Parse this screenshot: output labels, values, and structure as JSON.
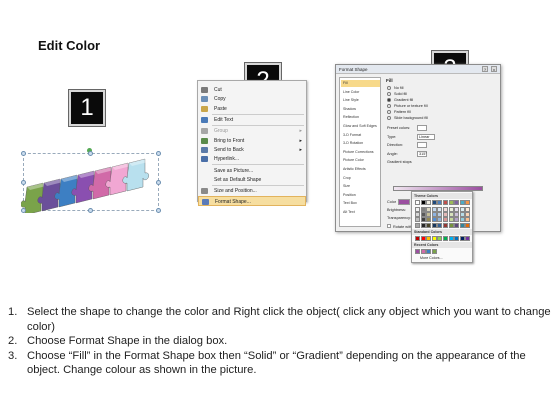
{
  "title": "Edit Color",
  "step_badges": [
    "1",
    "2",
    "3"
  ],
  "puzzle": {
    "colors": [
      "#7aa34a",
      "#6b4f9a",
      "#3d7fc3",
      "#8a4fb0",
      "#d16aa8",
      "#f1a7d3",
      "#b8e0ee"
    ]
  },
  "context_menu": {
    "items": [
      {
        "label": "Cut",
        "icon": "scissors-icon",
        "icon_color": "#7a7a7a",
        "has_submenu": false,
        "disabled": false,
        "selected": false
      },
      {
        "label": "Copy",
        "icon": "copy-icon",
        "icon_color": "#6b8fb8",
        "has_submenu": false,
        "disabled": false,
        "selected": false
      },
      {
        "label": "Paste",
        "icon": "paste-icon",
        "icon_color": "#c9a64a",
        "has_submenu": false,
        "disabled": false,
        "selected": false
      },
      {
        "label": "Edit Text",
        "icon": "edit-text-icon",
        "icon_color": "#4a7ab8",
        "has_submenu": false,
        "disabled": false,
        "selected": false
      },
      {
        "label": "Group",
        "icon": "group-icon",
        "icon_color": "#a6a6a6",
        "has_submenu": true,
        "disabled": true,
        "selected": false
      },
      {
        "label": "Bring to Front",
        "icon": "bring-front-icon",
        "icon_color": "#5a8a4a",
        "has_submenu": true,
        "disabled": false,
        "selected": false
      },
      {
        "label": "Send to Back",
        "icon": "send-back-icon",
        "icon_color": "#5a7aa8",
        "has_submenu": true,
        "disabled": false,
        "selected": false
      },
      {
        "label": "Hyperlink...",
        "icon": "hyperlink-icon",
        "icon_color": "#4a6fa8",
        "has_submenu": false,
        "disabled": false,
        "selected": false
      },
      {
        "label": "Save as Picture...",
        "icon": "",
        "icon_color": "",
        "has_submenu": false,
        "disabled": false,
        "selected": false
      },
      {
        "label": "Set as Default Shape",
        "icon": "",
        "icon_color": "",
        "has_submenu": false,
        "disabled": false,
        "selected": false
      },
      {
        "label": "Size and Position...",
        "icon": "size-position-icon",
        "icon_color": "#8a8a8a",
        "has_submenu": false,
        "disabled": false,
        "selected": false
      },
      {
        "label": "Format Shape...",
        "icon": "format-shape-icon",
        "icon_color": "#5a7ab8",
        "has_submenu": false,
        "disabled": false,
        "selected": true
      }
    ]
  },
  "format_dialog": {
    "title": "Format Shape",
    "window_buttons": [
      "?",
      "x"
    ],
    "categories": [
      "Fill",
      "Line Color",
      "Line Style",
      "Shadow",
      "Reflection",
      "Glow and Soft Edges",
      "3-D Format",
      "3-D Rotation",
      "Picture Corrections",
      "Picture Color",
      "Artistic Effects",
      "Crop",
      "Size",
      "Position",
      "Text Box",
      "Alt Text"
    ],
    "selected_category": "Fill",
    "pane_heading": "Fill",
    "fill_options": [
      {
        "label": "No fill",
        "checked": false
      },
      {
        "label": "Solid fill",
        "checked": false
      },
      {
        "label": "Gradient fill",
        "checked": true
      },
      {
        "label": "Picture or texture fill",
        "checked": false
      },
      {
        "label": "Pattern fill",
        "checked": false
      },
      {
        "label": "Slide background fill",
        "checked": false
      }
    ],
    "fields": [
      {
        "label": "Preset colors:",
        "value": ""
      },
      {
        "label": "Type:",
        "value": "Linear"
      },
      {
        "label": "Direction:",
        "value": ""
      },
      {
        "label": "Angle:",
        "value": "315°"
      },
      {
        "label": "Gradient stops",
        "value": ""
      }
    ],
    "lower_labels": [
      "Color",
      "Brightness:",
      "Transparency:",
      "Rotate with shape"
    ],
    "gradient_colors": [
      "#f0e6f0",
      "#9b4fa0"
    ]
  },
  "palette": {
    "theme_heading": "Theme Colors",
    "standard_heading": "Standard Colors",
    "recent_heading": "Recent Colors",
    "more_label": "More Colors...",
    "theme_top": [
      "#ffffff",
      "#000000",
      "#eeece1",
      "#1f497d",
      "#4f81bd",
      "#c0504d",
      "#9bbb59",
      "#8064a2",
      "#4bacc6",
      "#f79646"
    ],
    "theme_shades": [
      [
        "#f2f2f2",
        "#7f7f7f",
        "#ddd9c3",
        "#c6d9f0",
        "#dbe5f1",
        "#f2dcdb",
        "#ebf1dd",
        "#e5e0ec",
        "#dbeef3",
        "#fdeada"
      ],
      [
        "#d8d8d8",
        "#595959",
        "#c4bd97",
        "#8db3e2",
        "#b8cce4",
        "#e5b9b7",
        "#d7e3bc",
        "#ccc1d9",
        "#b7dde8",
        "#fbd5b5"
      ],
      [
        "#bfbfbf",
        "#3f3f3f",
        "#938953",
        "#548dd4",
        "#95b3d7",
        "#d99694",
        "#c3d69b",
        "#b2a2c7",
        "#92cddc",
        "#fac08f"
      ],
      [
        "#a5a5a5",
        "#262626",
        "#494429",
        "#17365d",
        "#366092",
        "#953734",
        "#76923c",
        "#5f497a",
        "#31859b",
        "#e36c09"
      ]
    ],
    "standard": [
      "#c00000",
      "#ff0000",
      "#ffc000",
      "#ffff00",
      "#92d050",
      "#00b050",
      "#00b0f0",
      "#0070c0",
      "#002060",
      "#7030a0"
    ],
    "recent": [
      "#9b4fa0",
      "#d16aa8",
      "#3d7fc3",
      "#7aa34a"
    ]
  },
  "instructions": [
    {
      "num": "1.",
      "text": "Select the shape to change the color and Right click the object( click any object which you want to change color)"
    },
    {
      "num": "2.",
      "text": "Choose Format Shape in the dialog box."
    },
    {
      "num": "3.",
      "text": "Choose “Fill” in the Format Shape box then “Solid” or “Gradient” depending on the appearance of the object. Change colour as shown in the picture."
    }
  ]
}
